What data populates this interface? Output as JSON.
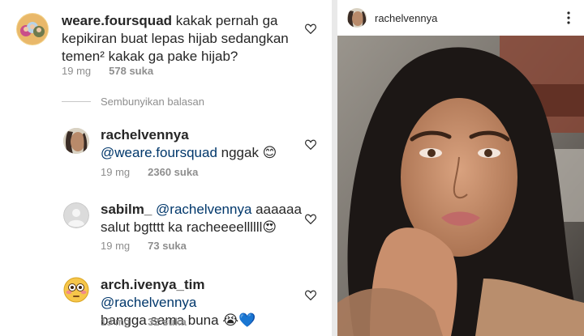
{
  "comments": [
    {
      "username": "weare.foursquad",
      "text": "kakak pernah ga kepikiran buat lepas hijab sedangkan temen² kakak ga pake hijab?",
      "time": "19 mg",
      "likes": "578 suka",
      "avatar_icon": "group-photo-avatar"
    },
    {
      "username": "rachelvennya",
      "mention": "@weare.foursquad",
      "text": "nggak 😊",
      "time": "19 mg",
      "likes": "2360 suka",
      "avatar_icon": "profile-photo-avatar"
    },
    {
      "username": "sabilm_",
      "mention": "@rachelvennya",
      "text_line1": "aaaaaa",
      "text_line2": "salut bgtttt ka racheeeellllll😍",
      "time": "19 mg",
      "likes": "73 suka",
      "avatar_icon": "default-user-avatar"
    },
    {
      "username": "arch.ivenya_tim",
      "mention": "@rachelvennya",
      "text": "bangga sama buna 😭💙",
      "time": "19 mg",
      "likes": "32 suka",
      "avatar_icon": "flushed-emoji-avatar"
    }
  ],
  "replies_toggle": "Sembunyikan balasan",
  "post": {
    "username": "rachelvennya",
    "more_icon": "more-vertical-icon",
    "photo": "selfie-photo"
  },
  "colors": {
    "text": "#262626",
    "meta": "#8e8e8e",
    "mention": "#00376b",
    "divider": "#e9e9e9"
  }
}
